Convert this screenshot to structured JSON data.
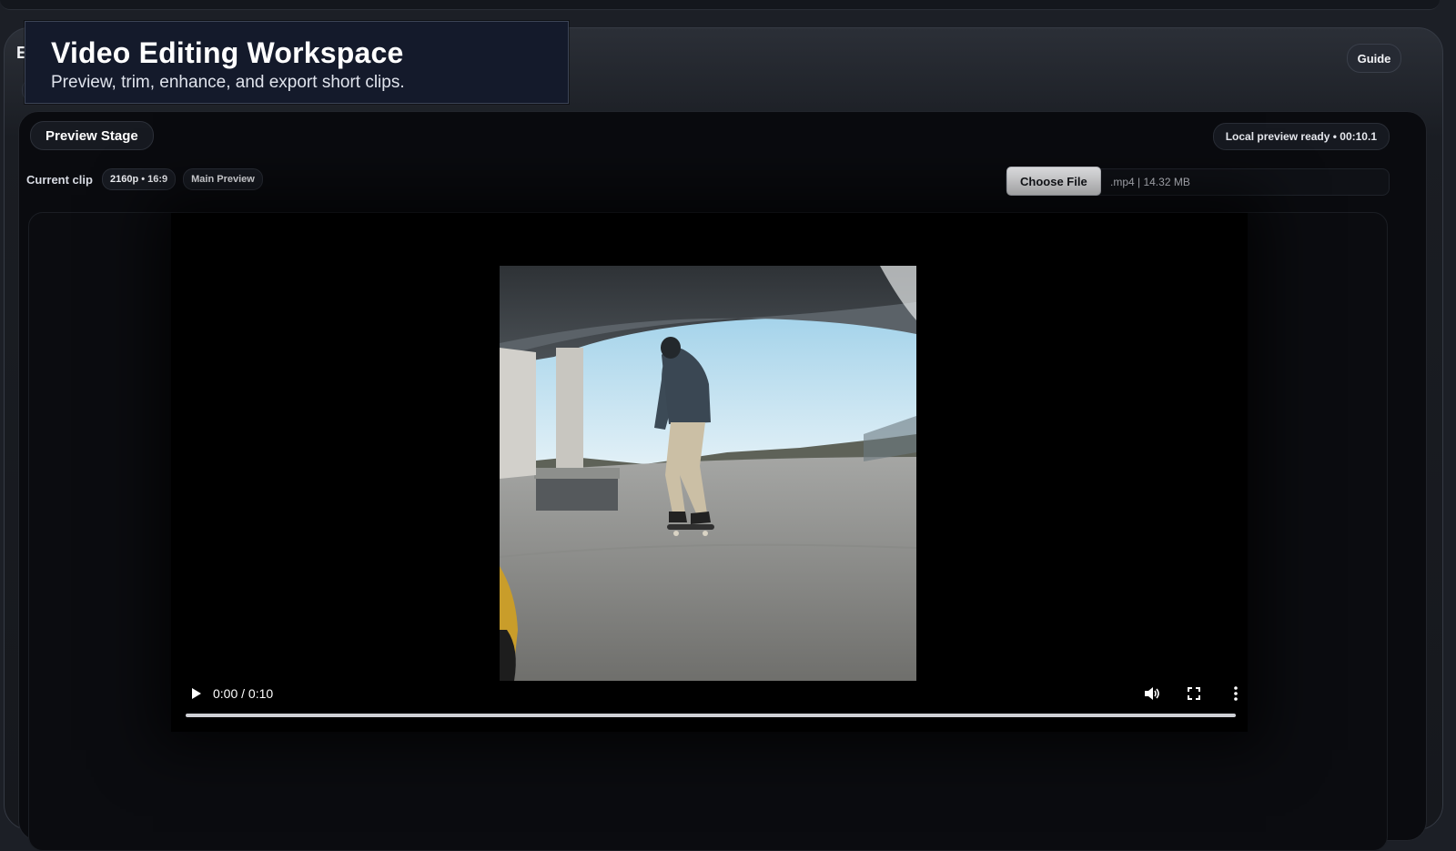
{
  "window": {
    "underlay_title": "Edito"
  },
  "overlay": {
    "title": "Video Editing Workspace",
    "subtitle": "Preview, trim, enhance, and export short clips."
  },
  "header": {
    "guide_label": "Guide"
  },
  "stage": {
    "title": "Preview Stage",
    "status": "Local preview ready • 00:10.1",
    "current_clip_label": "Current clip",
    "tags": [
      "2160p • 16:9",
      "Main Preview"
    ],
    "file": {
      "button_label": "Choose File",
      "meta": ".mp4 | 14.32 MB"
    }
  },
  "player": {
    "time": "0:00 / 0:10",
    "progress": 0,
    "icons": {
      "play": "play-icon",
      "volume": "volume-icon",
      "fullscreen": "fullscreen-icon",
      "menu": "more-vertical-icon"
    }
  }
}
